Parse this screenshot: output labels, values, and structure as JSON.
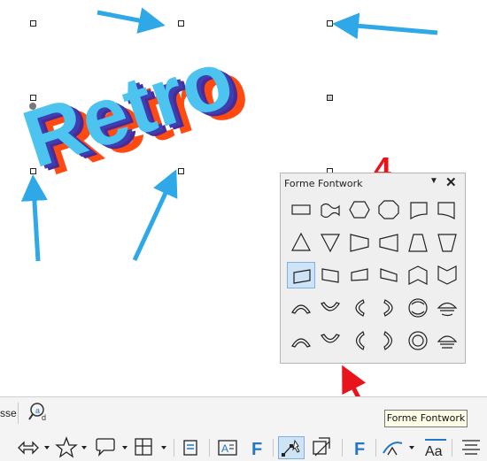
{
  "canvas": {
    "fontwork_text": "Retro"
  },
  "fontwork_panel": {
    "title": "Forme Fontwork",
    "menu_icon": "triangle-down-icon",
    "close_icon": "close-icon",
    "shapes": [
      "rectangle",
      "wave",
      "hexagon",
      "octagon",
      "curved-bottom-left",
      "curved-bottom-right",
      "triangle-up",
      "triangle-down",
      "trapezoid-right",
      "trapezoid-left",
      "trapezoid-up",
      "trapezoid-down",
      "slant-up",
      "slant-down",
      "fade-right",
      "fade-left",
      "chevron-up",
      "chevron-down",
      "arch-up",
      "arch-down",
      "arch-left",
      "arch-right",
      "circle-pour",
      "button-pour",
      "arch-up-pour",
      "arch-down-pour",
      "arch-left-pour",
      "arch-right-pour",
      "circle",
      "button"
    ],
    "selected_index": 12
  },
  "annotation": {
    "step_number": "4",
    "color": "#e8141b",
    "arrow_color": "#2ea8e6"
  },
  "toolbar": {
    "cut_label": "sse",
    "tooltip": "Forme Fontwork",
    "icons": [
      "find-replace-icon",
      "double-arrow-icon",
      "star-icon",
      "callout-icon",
      "layout-icon",
      "text-frame-icon",
      "text-box-icon",
      "fontwork-f-icon",
      "points-icon",
      "transformations-icon",
      "fontwork-icon",
      "fontwork-shape-icon",
      "character-icon",
      "align-icon"
    ]
  }
}
